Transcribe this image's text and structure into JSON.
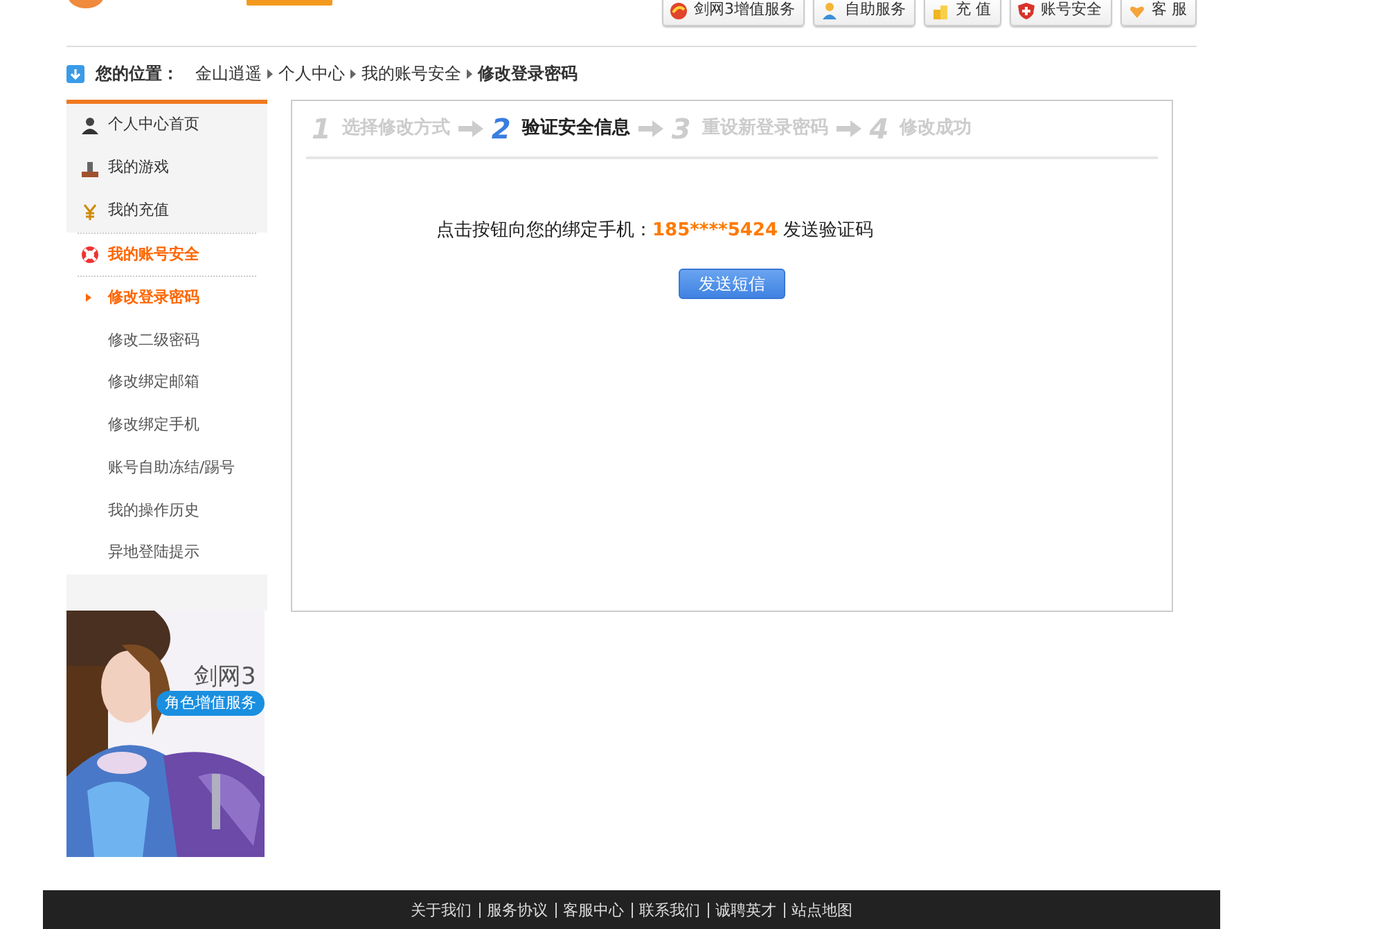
{
  "header": {
    "buttons": [
      {
        "label": "剑网3增值服务"
      },
      {
        "label": "自助服务"
      },
      {
        "label": "充 值"
      },
      {
        "label": "账号安全"
      },
      {
        "label": "客 服"
      }
    ]
  },
  "breadcrumb": {
    "label": "您的位置：",
    "items": [
      "金山逍遥",
      "个人中心",
      "我的账号安全",
      "修改登录密码"
    ]
  },
  "sidebar": {
    "items": [
      {
        "label": "个人中心首页",
        "selected": false
      },
      {
        "label": "我的游戏",
        "selected": false
      },
      {
        "label": "我的充值",
        "selected": false
      },
      {
        "label": "我的账号安全",
        "selected": true,
        "children": [
          {
            "label": "修改登录密码",
            "selected": true
          },
          {
            "label": "修改二级密码",
            "selected": false
          },
          {
            "label": "修改绑定邮箱",
            "selected": false
          },
          {
            "label": "修改绑定手机",
            "selected": false
          },
          {
            "label": "账号自助冻结/踢号",
            "selected": false
          },
          {
            "label": "我的操作历史",
            "selected": false
          },
          {
            "label": "异地登陆提示",
            "selected": false
          }
        ]
      }
    ],
    "banner": {
      "kind": "picture",
      "title": "剑网3",
      "tag": "角色增值服务"
    }
  },
  "steps": [
    {
      "number": "1",
      "label": "选择修改方式",
      "selected": false
    },
    {
      "number": "2",
      "label": "验证安全信息",
      "selected": true
    },
    {
      "number": "3",
      "label": "重设新登录密码",
      "selected": false
    },
    {
      "number": "4",
      "label": "修改成功",
      "selected": false
    }
  ],
  "message": {
    "prefix": "点击按钮向您的绑定手机：",
    "phone": "185****5424",
    "suffix": " 发送验证码"
  },
  "send_button": "发送短信",
  "footer": {
    "links": [
      "关于我们",
      "服务协议",
      "客服中心",
      "联系我们",
      "诚聘英才",
      "站点地图"
    ]
  }
}
